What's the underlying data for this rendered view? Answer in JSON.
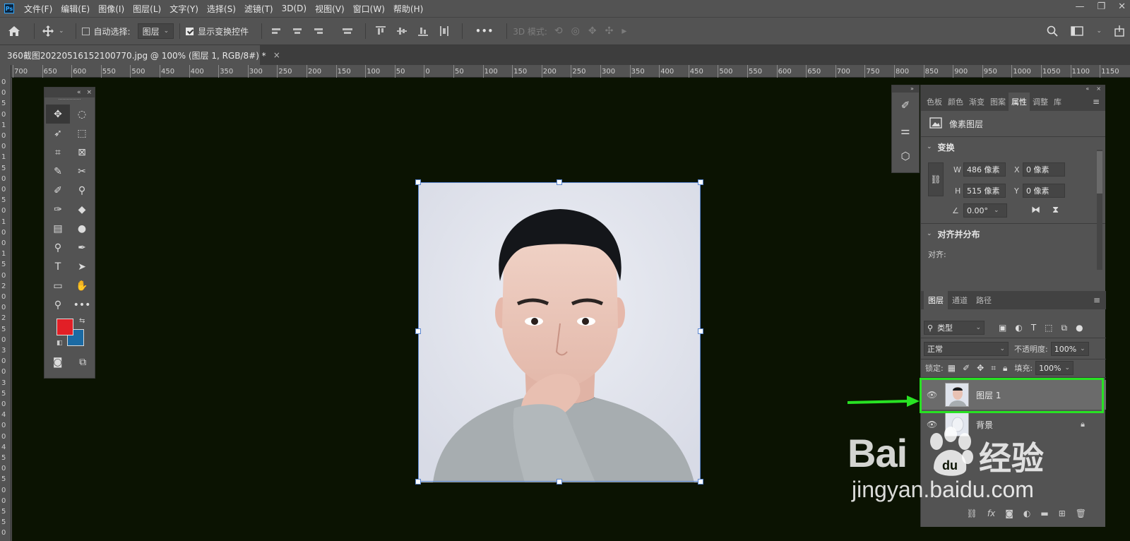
{
  "menubar": {
    "logo": "Ps",
    "items": [
      "文件(F)",
      "编辑(E)",
      "图像(I)",
      "图层(L)",
      "文字(Y)",
      "选择(S)",
      "滤镜(T)",
      "3D(D)",
      "视图(V)",
      "窗口(W)",
      "帮助(H)"
    ]
  },
  "options": {
    "auto_select_label": "自动选择:",
    "auto_select_value": "图层",
    "show_transform_label": "显示变换控件",
    "more": "•••",
    "mode3d_label": "3D 模式:"
  },
  "document": {
    "tab_title": "360截图20220516152100770.jpg @ 100% (图层 1, RGB/8#) *",
    "close": "×"
  },
  "ruler": {
    "h_ticks": [
      "700",
      "650",
      "600",
      "550",
      "500",
      "450",
      "400",
      "350",
      "300",
      "250",
      "200",
      "150",
      "100",
      "50",
      "0",
      "50",
      "100",
      "150",
      "200",
      "250",
      "300",
      "350",
      "400",
      "450",
      "500",
      "550",
      "600",
      "650",
      "700",
      "750",
      "800",
      "850",
      "900",
      "950",
      "1000",
      "1050",
      "1100",
      "1150"
    ],
    "v_ticks": [
      "0",
      "0",
      "5",
      "0",
      "1",
      "0",
      "0",
      "1",
      "5",
      "0",
      "0",
      "5",
      "0",
      "1",
      "0",
      "0",
      "1",
      "5",
      "0",
      "2",
      "0",
      "0",
      "2",
      "5",
      "0",
      "3",
      "0",
      "0",
      "3",
      "5",
      "0",
      "4",
      "0",
      "0",
      "4",
      "5",
      "0",
      "5",
      "0",
      "0",
      "5",
      "5",
      "0"
    ]
  },
  "toolbox": {
    "collapse": "«",
    "close": "×",
    "fg_color": "#e21f26",
    "bg_color": "#1b6aa3"
  },
  "properties": {
    "tabs": [
      "色板",
      "颜色",
      "渐变",
      "图案",
      "属性",
      "调整",
      "库"
    ],
    "active_tab": "属性",
    "layer_type": "像素图层",
    "transform_title": "变换",
    "w_label": "W",
    "w_value": "486 像素",
    "h_label": "H",
    "h_value": "515 像素",
    "x_label": "X",
    "x_value": "0 像素",
    "y_label": "Y",
    "y_value": "0 像素",
    "angle_value": "0.00°",
    "align_title": "对齐并分布",
    "align_label": "对齐:"
  },
  "layers": {
    "tabs": [
      "图层",
      "通道",
      "路径"
    ],
    "filter_kind": "类型",
    "blend_mode": "正常",
    "opacity_label": "不透明度:",
    "opacity_value": "100%",
    "lock_label": "锁定:",
    "fill_label": "填充:",
    "fill_value": "100%",
    "items": [
      {
        "name": "图层 1",
        "selected": true
      },
      {
        "name": "背景",
        "locked": true
      }
    ],
    "footer_fx": "fx"
  },
  "watermark": {
    "brand": "Bai",
    "brand2": "经验",
    "url": "jingyan.baidu.com"
  },
  "colors": {
    "ui": "#535353",
    "canvas": "#0b1302",
    "highlight": "#28e223"
  }
}
